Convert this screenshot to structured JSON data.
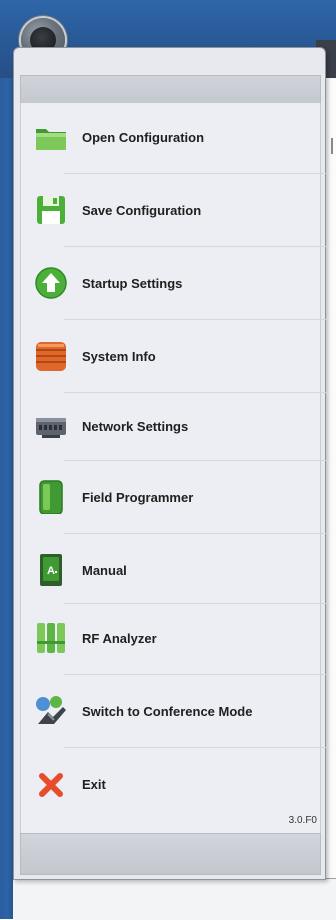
{
  "menu": {
    "items": [
      {
        "label": "Open Configuration",
        "icon": "folder-open-icon"
      },
      {
        "label": "Save Configuration",
        "icon": "floppy-disk-icon"
      },
      {
        "label": "Startup Settings",
        "icon": "arrow-up-circle-icon"
      },
      {
        "label": "System Info",
        "icon": "stacked-box-icon"
      },
      {
        "label": "Network Settings",
        "icon": "network-device-icon"
      },
      {
        "label": "Field Programmer",
        "icon": "green-module-icon"
      },
      {
        "label": "Manual",
        "icon": "manual-book-icon"
      },
      {
        "label": "RF Analyzer",
        "icon": "rf-bars-icon"
      },
      {
        "label": "Switch to Conference Mode",
        "icon": "conference-mode-icon"
      },
      {
        "label": "Exit",
        "icon": "close-x-icon"
      }
    ],
    "version": "3.0.F0"
  },
  "colors": {
    "titlebar": "#2b5fa0",
    "menu_bg": "#eceef3",
    "accent_green": "#4caf3a",
    "accent_orange": "#e0672a",
    "exit_red": "#e74c2b"
  }
}
